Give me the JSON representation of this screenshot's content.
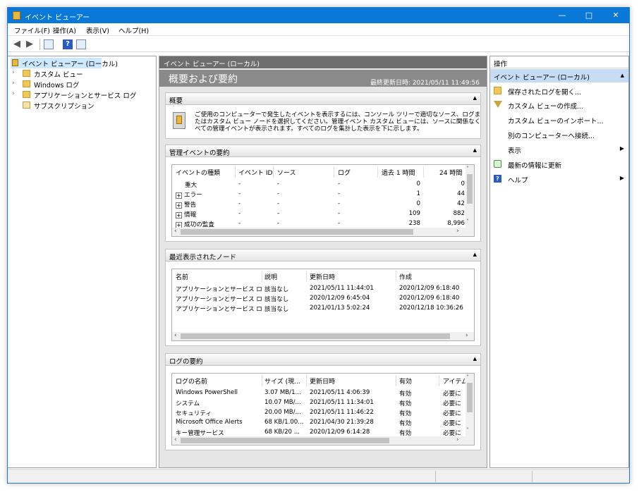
{
  "window": {
    "title": "イベント ビューアー"
  },
  "menu": [
    "ファイル(F)",
    "操作(A)",
    "表示(V)",
    "ヘルプ(H)"
  ],
  "tree": [
    {
      "label": "イベント ビューアー (ローカル)",
      "icon": "event-viewer-icon"
    },
    {
      "label": "カスタム ビュー",
      "icon": "folder-icon"
    },
    {
      "label": "Windows ログ",
      "icon": "folder-icon"
    },
    {
      "label": "アプリケーションとサービス ログ",
      "icon": "folder-icon"
    },
    {
      "label": "サブスクリプション",
      "icon": "subscription-icon"
    }
  ],
  "center": {
    "header": "イベント ビューアー (ローカル)",
    "banner_title": "概要および要約",
    "last_updated": "最終更新日時: 2021/05/11 11:49:56",
    "overview": {
      "title": "概要",
      "text1": "ご使用のコンピューターで発生したイベントを表示するには、コンソール ツリーで適切なソース、ログま",
      "text2": "たはカスタム ビュー ノードを選択してください。管理イベント カスタム ビューには、ソースに関係なく",
      "text3": "べての管理イベントが表示されます。すべてのログを集計した表示を下に示します。"
    },
    "admin": {
      "title": "管理イベントの要約",
      "columns": [
        "イベントの種類",
        "イベント ID",
        "ソース",
        "ログ",
        "過去 1 時間",
        "24 時間"
      ],
      "rows": [
        {
          "pm": "",
          "type": "重大",
          "id": "-",
          "source": "-",
          "log": "-",
          "hour": "0",
          "day": "0"
        },
        {
          "pm": "+",
          "type": "エラー",
          "id": "-",
          "source": "-",
          "log": "-",
          "hour": "1",
          "day": "44"
        },
        {
          "pm": "+",
          "type": "警告",
          "id": "-",
          "source": "-",
          "log": "-",
          "hour": "0",
          "day": "42"
        },
        {
          "pm": "+",
          "type": "情報",
          "id": "-",
          "source": "-",
          "log": "-",
          "hour": "109",
          "day": "882"
        },
        {
          "pm": "+",
          "type": "成功の監査",
          "id": "-",
          "source": "-",
          "log": "-",
          "hour": "238",
          "day": "8,996"
        }
      ]
    },
    "recent": {
      "title": "最近表示されたノード",
      "columns": [
        "名前",
        "説明",
        "更新日時",
        "作成"
      ],
      "rows": [
        {
          "name": "アプリケーションとサービス ログ...",
          "desc": "該当なし",
          "updated": "2021/05/11 11:44:01",
          "created": "2020/12/09 6:18:40"
        },
        {
          "name": "アプリケーションとサービス ログ...",
          "desc": "該当なし",
          "updated": "2020/12/09 6:45:04",
          "created": "2020/12/09 6:18:40"
        },
        {
          "name": "アプリケーションとサービス ログ...",
          "desc": "該当なし",
          "updated": "2021/01/13 5:02:24",
          "created": "2020/12/18 10:36:26"
        }
      ]
    },
    "logs": {
      "title": "ログの要約",
      "columns": [
        "ログの名前",
        "サイズ (現...",
        "更新日時",
        "有効",
        "アイテム"
      ],
      "rows": [
        {
          "name": "Windows PowerShell",
          "size": "3.07 MB/1...",
          "updated": "2021/05/11 4:06:39",
          "enabled": "有効",
          "items": "必要に"
        },
        {
          "name": "システム",
          "size": "10.07 MB/...",
          "updated": "2021/05/11 11:34:01",
          "enabled": "有効",
          "items": "必要に"
        },
        {
          "name": "セキュリティ",
          "size": "20.00 MB/...",
          "updated": "2021/05/11 11:46:22",
          "enabled": "有効",
          "items": "必要に"
        },
        {
          "name": "Microsoft Office Alerts",
          "size": "68 KB/1.00...",
          "updated": "2021/04/30 21:39:28",
          "enabled": "有効",
          "items": "必要に"
        },
        {
          "name": "キー管理サービス",
          "size": "68 KB/20 ...",
          "updated": "2020/12/09 6:14:28",
          "enabled": "有効",
          "items": "必要に"
        }
      ]
    }
  },
  "actions": {
    "header": "操作",
    "subheader": "イベント ビューアー (ローカル)",
    "items": [
      {
        "label": "保存されたログを開く...",
        "icon": "open-folder-icon"
      },
      {
        "label": "カスタム ビューの作成...",
        "icon": "filter-icon"
      },
      {
        "label": "カスタム ビューのインポート...",
        "icon": ""
      },
      {
        "label": "別のコンピューターへ接続...",
        "icon": ""
      },
      {
        "label": "表示",
        "icon": ""
      },
      {
        "label": "最新の情報に更新",
        "icon": "refresh-icon"
      },
      {
        "label": "ヘルプ",
        "icon": "help-icon"
      }
    ]
  }
}
